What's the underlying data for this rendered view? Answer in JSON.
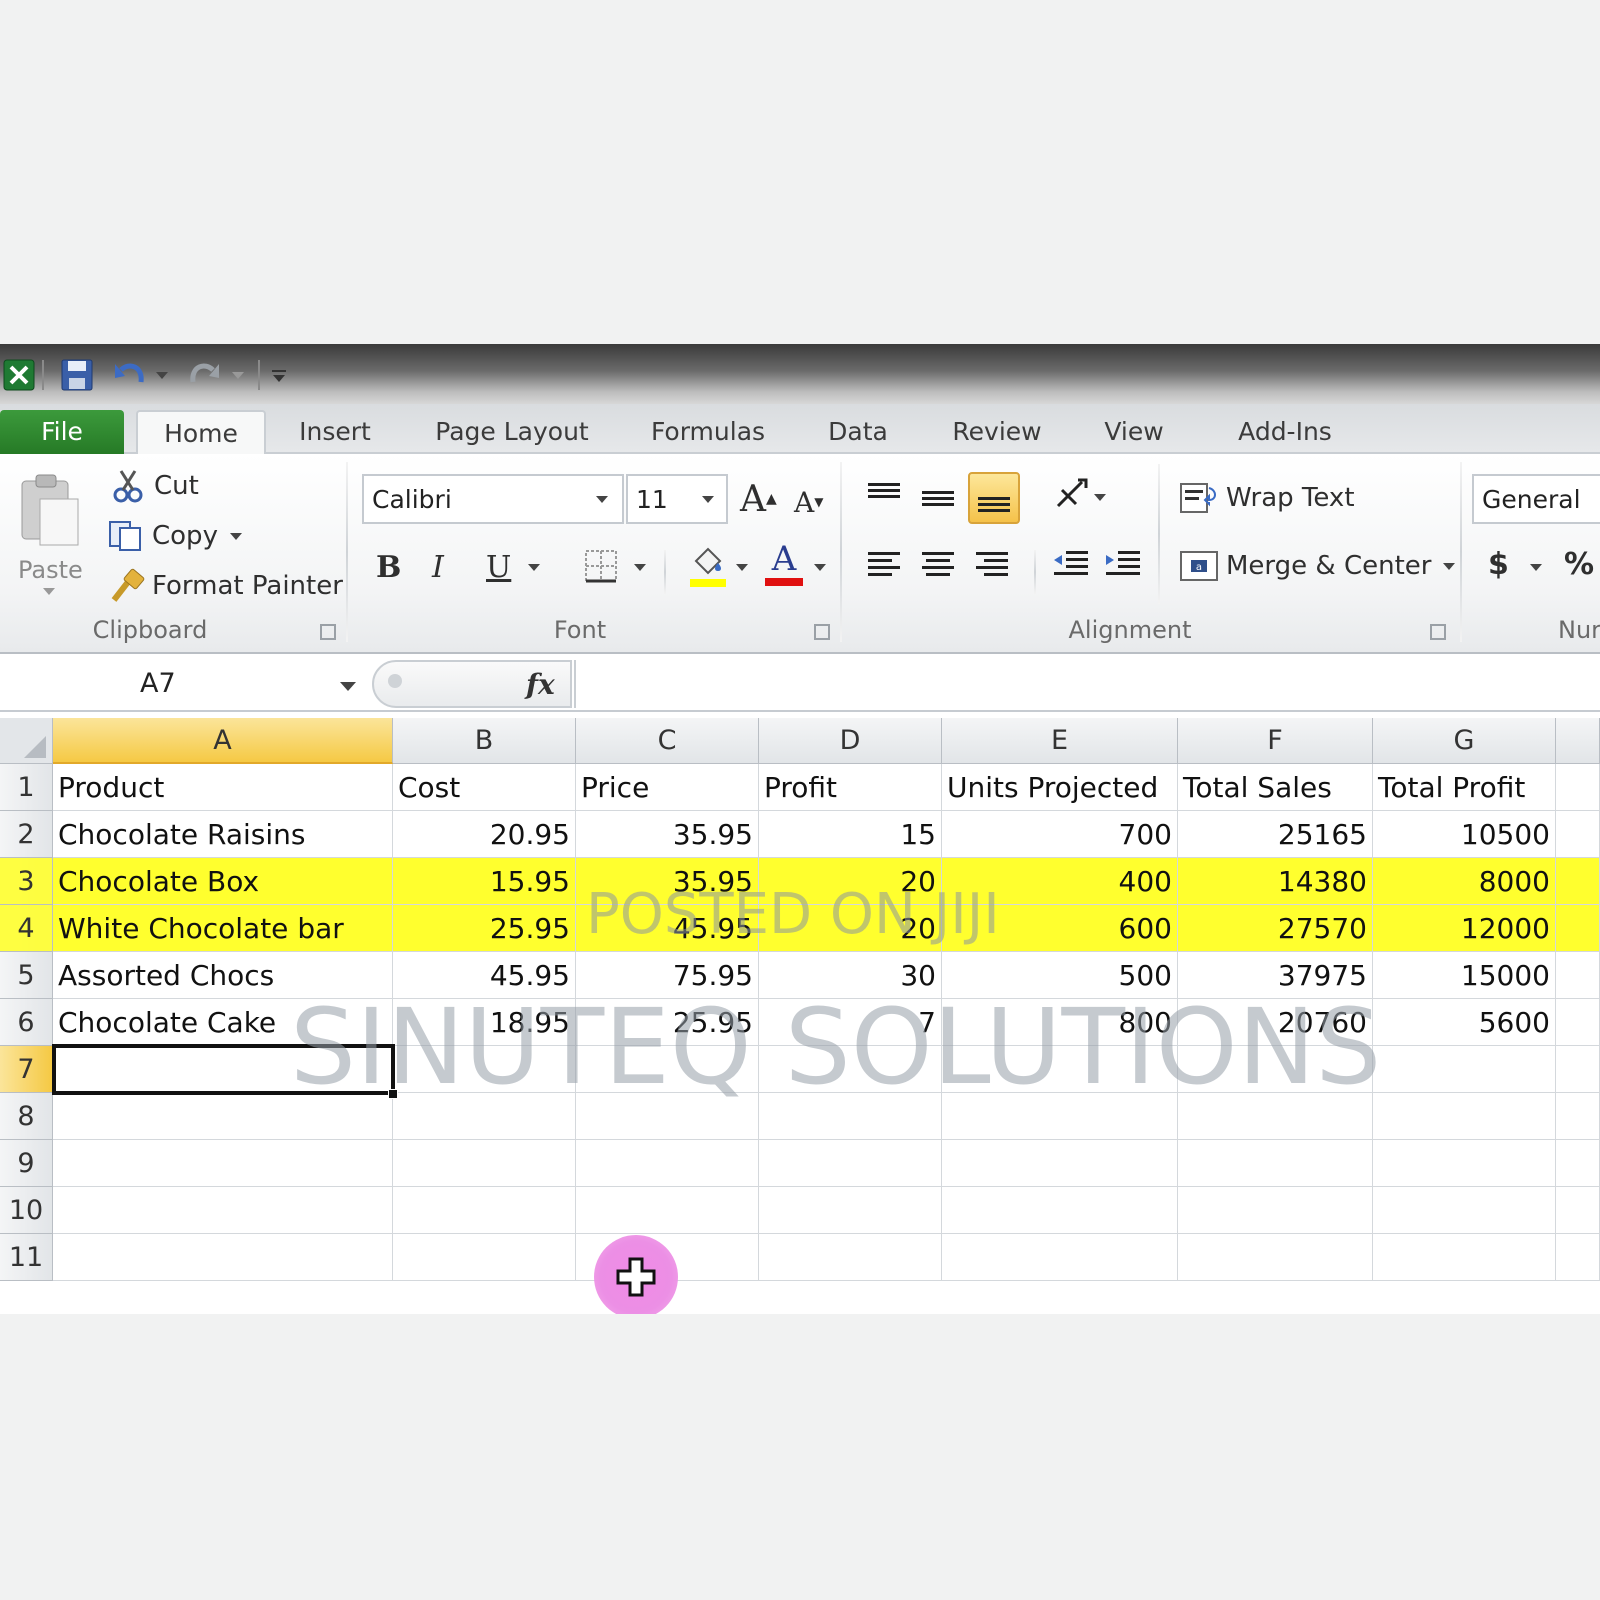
{
  "tabs": [
    "File",
    "Home",
    "Insert",
    "Page Layout",
    "Formulas",
    "Data",
    "Review",
    "View",
    "Add-Ins"
  ],
  "clipboard": {
    "paste": "Paste",
    "cut": "Cut",
    "copy": "Copy",
    "format_painter": "Format Painter",
    "label": "Clipboard"
  },
  "font": {
    "name": "Calibri",
    "size": "11",
    "bold": "B",
    "italic": "I",
    "underline": "U",
    "font_color_glyph": "A",
    "grow_glyph": "A",
    "shrink_glyph": "A",
    "label": "Font"
  },
  "alignment": {
    "wrap_text": "Wrap Text",
    "merge_center": "Merge & Center",
    "label": "Alignment"
  },
  "number": {
    "format": "General",
    "currency": "$",
    "percent": "%",
    "label": "Nur"
  },
  "formula_bar": {
    "name_box": "A7",
    "fx": "fx",
    "value": ""
  },
  "grid": {
    "columns": [
      "A",
      "B",
      "C",
      "D",
      "E",
      "F",
      "G"
    ],
    "row_numbers": [
      "1",
      "2",
      "3",
      "4",
      "5",
      "6",
      "7",
      "8",
      "9",
      "10",
      "11"
    ],
    "rows": [
      [
        "Product",
        "Cost",
        "Price",
        "Profit",
        "Units Projected",
        "Total Sales",
        "Total Profit"
      ],
      [
        "Chocolate Raisins",
        "20.95",
        "35.95",
        "15",
        "700",
        "25165",
        "10500"
      ],
      [
        "Chocolate Box",
        "15.95",
        "35.95",
        "20",
        "400",
        "14380",
        "8000"
      ],
      [
        "White Chocolate bar",
        "25.95",
        "45.95",
        "20",
        "600",
        "27570",
        "12000"
      ],
      [
        "Assorted Chocs",
        "45.95",
        "75.95",
        "30",
        "500",
        "37975",
        "15000"
      ],
      [
        "Chocolate Cake",
        "18.95",
        "25.95",
        "7",
        "800",
        "20760",
        "5600"
      ],
      [
        "",
        "",
        "",
        "",
        "",
        "",
        ""
      ],
      [
        "",
        "",
        "",
        "",
        "",
        "",
        ""
      ],
      [
        "",
        "",
        "",
        "",
        "",
        "",
        ""
      ],
      [
        "",
        "",
        "",
        "",
        "",
        "",
        ""
      ],
      [
        "",
        "",
        "",
        "",
        "",
        "",
        ""
      ]
    ],
    "highlighted_rows": [
      3,
      4
    ],
    "active_cell": "A7",
    "highlight_color": "#ffff2e"
  },
  "watermarks": {
    "small": "POSTED ON JIJI",
    "large": "SINUTEQ SOLUTIONS"
  },
  "colors": {
    "file_tab": "#2e8b2e",
    "accent_selection": "#f5c944",
    "cursor": "#ee8fe6"
  }
}
